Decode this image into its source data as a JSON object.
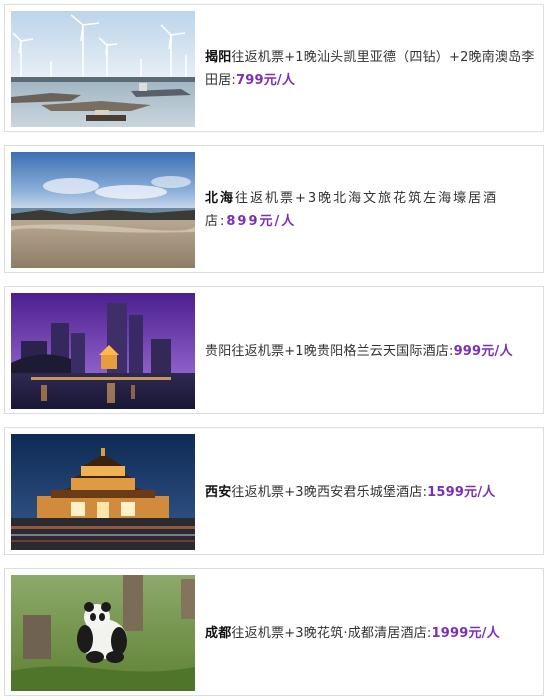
{
  "accent_color": "#7b2fb5",
  "items": [
    {
      "city": "揭阳",
      "details": "往返机票+1晚汕头凯里亚德（四钻）+2晚南澳岛李田居:",
      "price": "799元/人",
      "image_icon": "wind-turbines-harbor-photo"
    },
    {
      "city": "北海",
      "details": "往返机票+3晚北海文旅花筑左海壕居酒店:",
      "price": "899元/人",
      "image_icon": "beach-seascape-photo"
    },
    {
      "city": "贵阳",
      "details": "往返机票+1晚贵阳格兰云天国际酒店:",
      "price": "999元/人",
      "image_icon": "night-city-skyline-photo"
    },
    {
      "city": "西安",
      "details": "往返机票+3晚西安君乐城堡酒店:",
      "price": "1599元/人",
      "image_icon": "bell-tower-night-photo"
    },
    {
      "city": "成都",
      "details": "往返机票+3晚花筑·成都清居酒店:",
      "price": "1999元/人",
      "image_icon": "panda-grass-photo"
    }
  ]
}
